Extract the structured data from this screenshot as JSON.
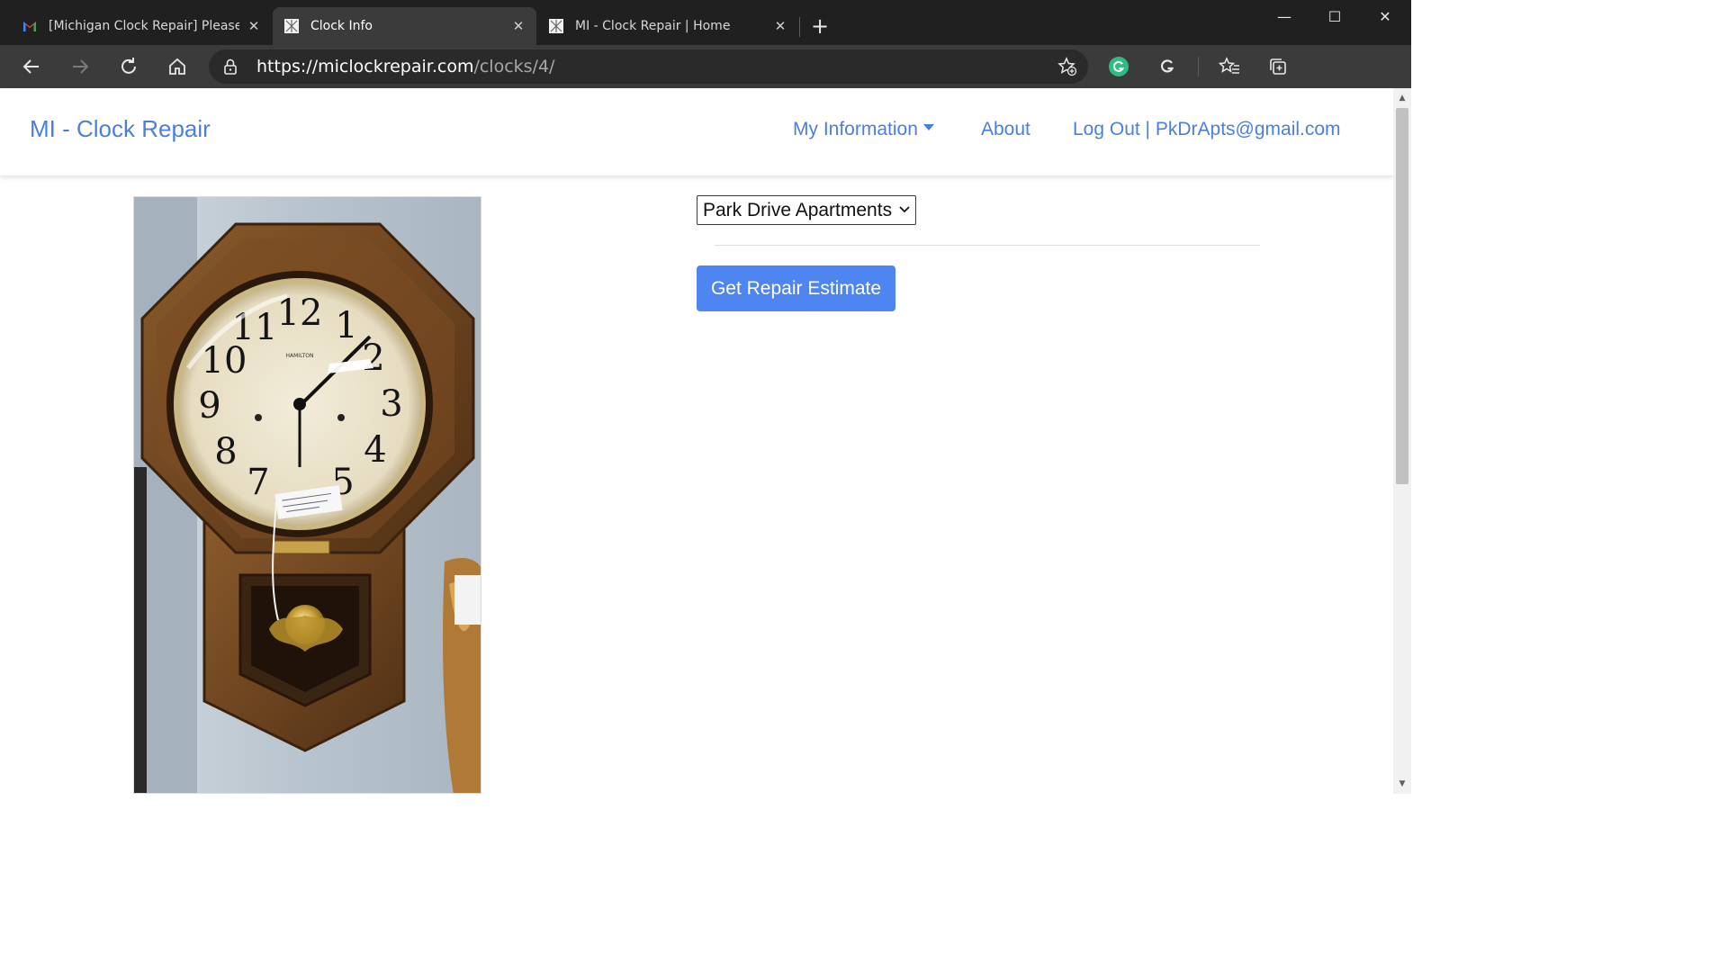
{
  "browser": {
    "tabs": [
      {
        "title": "[Michigan Clock Repair] Please C",
        "favicon": "gmail-icon",
        "active": false
      },
      {
        "title": "Clock Info",
        "favicon": "site-favicon",
        "active": true
      },
      {
        "title": "MI - Clock Repair | Home",
        "favicon": "site-favicon",
        "active": false
      }
    ],
    "new_tab_label": "+",
    "window": {
      "minimize": "—",
      "maximize": "☐",
      "close": "✕"
    },
    "address": {
      "scheme": "https://",
      "host": "miclockrepair.com",
      "path": "/clocks/4/"
    },
    "more_label": "···"
  },
  "site": {
    "brand": "MI - Clock Repair",
    "nav": {
      "my_information": "My Information",
      "about": "About",
      "logout": "Log Out | PkDrApts@gmail.com"
    }
  },
  "main": {
    "location_select": {
      "selected": "Park Drive Apartments"
    },
    "estimate_button": "Get Repair Estimate",
    "clock_numerals": [
      "12",
      "1",
      "2",
      "3",
      "4",
      "5",
      "7",
      "8",
      "9",
      "10",
      "11"
    ],
    "clock_brand": "HAMILTON"
  }
}
